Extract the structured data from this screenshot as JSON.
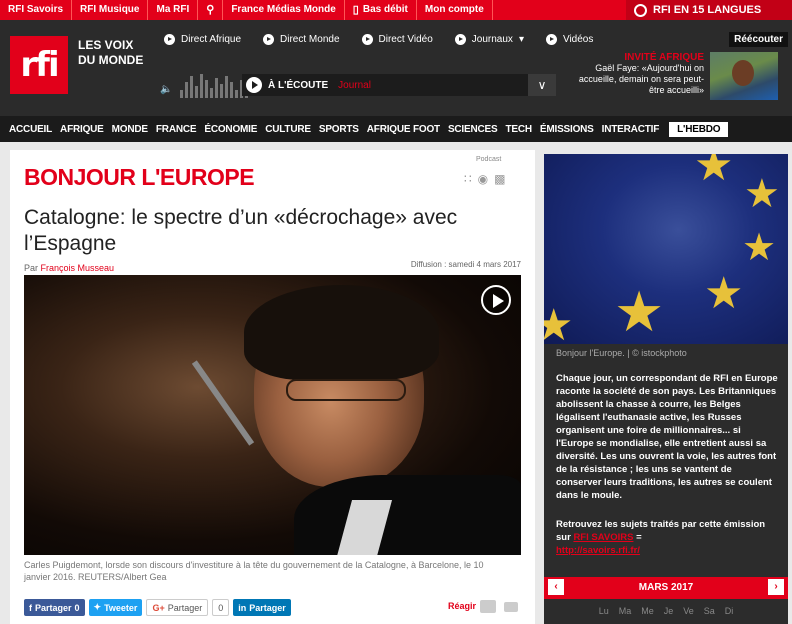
{
  "topbar": {
    "links": [
      "RFI Savoirs",
      "RFI Musique",
      "Ma RFI",
      "France Médias Monde",
      "Bas débit",
      "Mon compte"
    ],
    "langs": "RFI EN 15 LANGUES"
  },
  "header": {
    "logo": "rfi",
    "slogan_line1": "LES VOIX",
    "slogan_line2": "DU MONDE",
    "nav": [
      "Direct Afrique",
      "Direct Monde",
      "Direct Vidéo",
      "Journaux",
      "Vidéos"
    ],
    "journaux_chevron": "▾",
    "reecouter": "Réécouter",
    "ecoute_label": "À L'ÉCOUTE",
    "ecoute_program": "Journal",
    "invite_title": "INVITÉ AFRIQUE",
    "invite_desc": "Gaël Faye: «Aujourd'hui on accueille, demain on sera peut-être accueilli»"
  },
  "mainnav": {
    "items": [
      "ACCUEIL",
      "AFRIQUE",
      "MONDE",
      "FRANCE",
      "ÉCONOMIE",
      "CULTURE",
      "SPORTS",
      "AFRIQUE FOOT",
      "SCIENCES",
      "TECH",
      "ÉMISSIONS",
      "INTERACTIF"
    ],
    "hebdo": "L'HEBDO"
  },
  "article": {
    "section": "BONJOUR L'EUROPE",
    "podcast": "Podcast",
    "title": "Catalogne: le spectre d’un «décrochage» avec l’Espagne",
    "by": "Par",
    "author": "François Musseau",
    "diffusion": "Diffusion : samedi 4 mars 2017",
    "caption": "Carles Puigdemont, lorsde son discours d'investiture à la tête du gouvernement de la Catalogne, à Barcelone, le 10 janvier 2016. REUTERS/Albert Gea"
  },
  "share": {
    "fb": "Partager",
    "fb_count": "0",
    "tw": "Tweeter",
    "gp": "Partager",
    "gp_count": "0",
    "li": "Partager",
    "reagir": "Réagir"
  },
  "sidebar": {
    "caption": "Bonjour l'Europe. | © istockphoto",
    "text": "Chaque jour, un correspondant de RFI en Europe raconte la société de son pays. Les Britanniques abolissent la chasse à courre, les Belges légalisent l'euthanasie active, les Russes organisent une foire de millionnaires... si l'Europe se mondialise, elle entretient aussi sa diversité. Les uns ouvrent la voie, les autres font de la résistance ; les uns se vantent de conserver leurs traditions, les autres se coulent dans le moule.",
    "retrouvez": "Retrouvez les sujets traités par cette émission sur",
    "savoirs": "RFI SAVOIRS",
    "eq": " =",
    "url": "http://savoirs.rfi.fr/",
    "month": "MARS 2017",
    "prev": "‹",
    "next": "›",
    "days": [
      "Lu",
      "Ma",
      "Me",
      "Je",
      "Ve",
      "Sa",
      "Di"
    ]
  }
}
